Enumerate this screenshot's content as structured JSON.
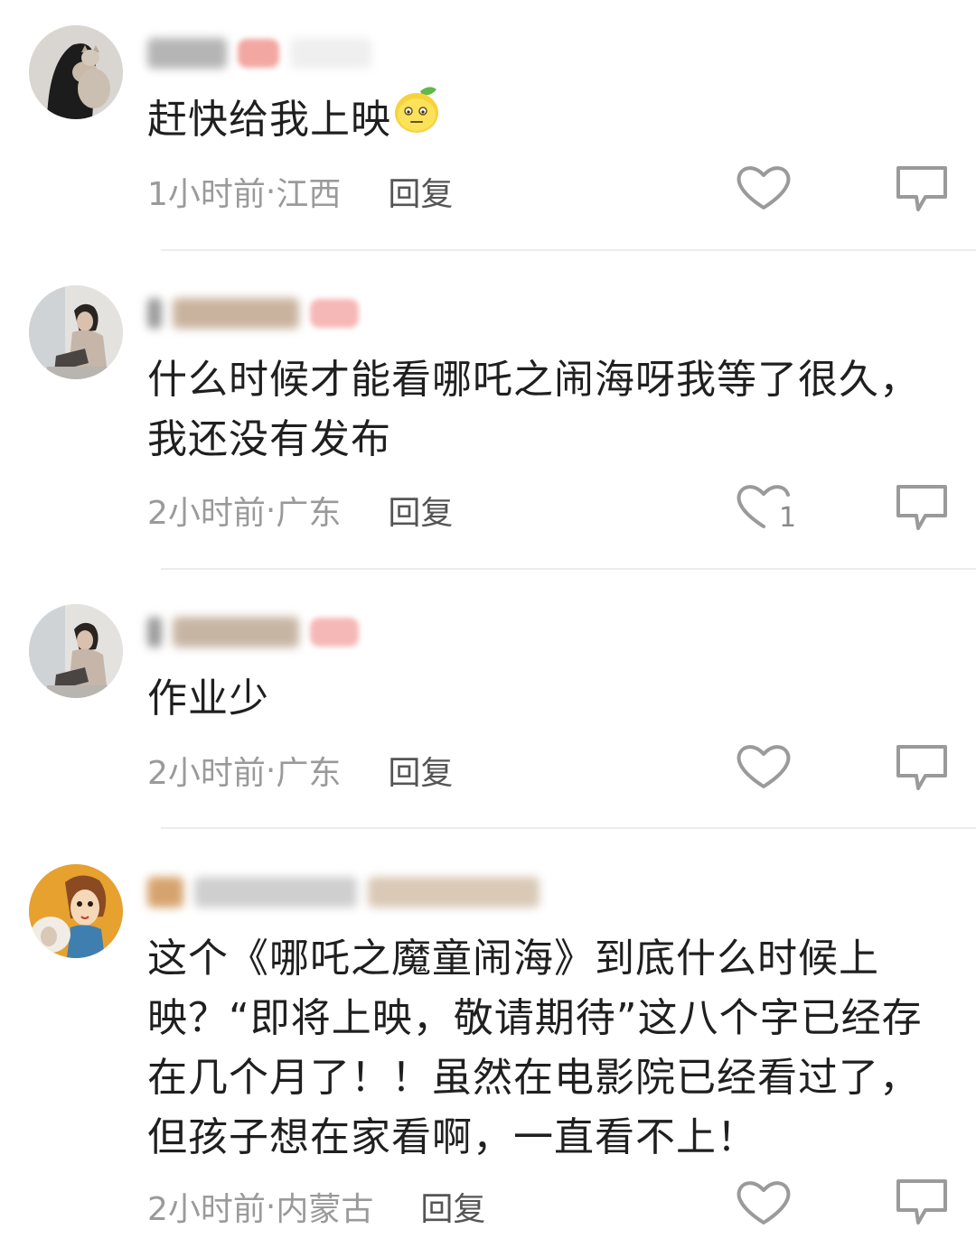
{
  "comments": [
    {
      "text": "赶快给我上映",
      "time": "1小时前",
      "location": "江西",
      "reply_label": "回复",
      "like_count": "",
      "avatar_icon": "avatar-girl-with-cat",
      "emoji_icon": "lemon-emoji-icon"
    },
    {
      "text": "什么时候才能看哪吒之闹海呀我等了很久，我还没有发布",
      "time": "2小时前",
      "location": "广东",
      "reply_label": "回复",
      "like_count": "1",
      "avatar_icon": "avatar-girl-sitting"
    },
    {
      "text": "作业少",
      "time": "2小时前",
      "location": "广东",
      "reply_label": "回复",
      "like_count": "",
      "avatar_icon": "avatar-girl-sitting"
    },
    {
      "text": "这个《哪吒之魔童闹海》到底什么时候上映？“即将上映，敬请期待”这八个字已经存在几个月了！！虽然在电影院已经看过了，但孩子想在家看啊，一直看不上！",
      "time": "2小时前",
      "location": "内蒙古",
      "reply_label": "回复",
      "like_count": "",
      "avatar_icon": "avatar-cartoon-girl-sheep"
    }
  ],
  "meta_separator": " · ",
  "colors": {
    "text": "#1f1f1f",
    "meta": "#9a9a9a",
    "reply": "#555555",
    "icon": "#999999",
    "divider": "#ececec"
  }
}
